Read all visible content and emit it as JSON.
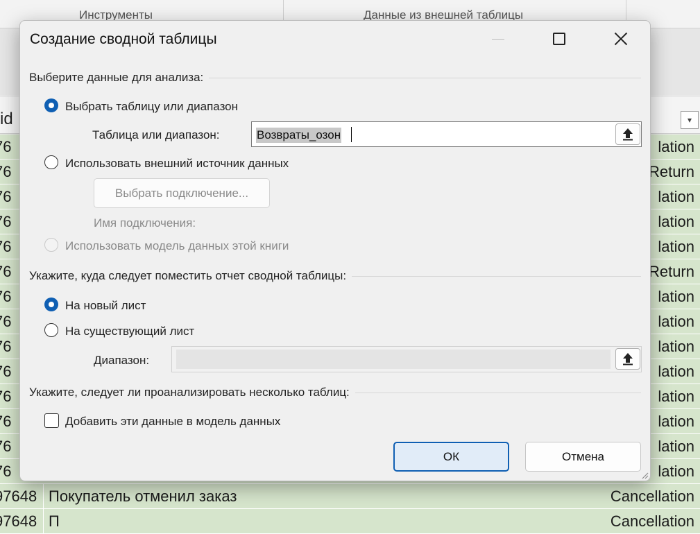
{
  "background": {
    "ribbon_groups": [
      "Инструменты",
      "Данные из внешней таблицы"
    ],
    "column_id_header": "id",
    "row_partial_id": "76",
    "rows": [
      {
        "status": "lation"
      },
      {
        "status": "Return"
      },
      {
        "status": "lation"
      },
      {
        "status": "lation"
      },
      {
        "status": "lation"
      },
      {
        "status": "Return"
      },
      {
        "status": "lation"
      },
      {
        "status": "lation"
      },
      {
        "status": "lation"
      },
      {
        "status": "lation"
      },
      {
        "status": "lation"
      },
      {
        "status": "lation"
      },
      {
        "status": "lation"
      },
      {
        "status": "lation"
      }
    ],
    "visible_row": {
      "id": "97648",
      "text": "Покупатель отменил заказ",
      "status": "Cancellation"
    },
    "last_row": {
      "id": "97648",
      "text": "П",
      "status": "Cancellation"
    },
    "row_color": "#d6e5cc"
  },
  "dialog": {
    "title": "Создание сводной таблицы",
    "section1": "Выберите данные для анализа:",
    "radio_table": "Выбрать таблицу или диапазон",
    "table_range_label": "Таблица или диапазон:",
    "table_range_value": "Возвраты_озон",
    "radio_external": "Использовать внешний источник данных",
    "choose_connection_button": "Выбрать подключение...",
    "connection_name_label": "Имя подключения:",
    "radio_data_model": "Использовать модель данных этой книги",
    "section2": "Укажите, куда следует поместить отчет сводной таблицы:",
    "radio_new_sheet": "На новый лист",
    "radio_existing_sheet": "На существующий лист",
    "range_label": "Диапазон:",
    "range_value": "",
    "section3": "Укажите, следует ли проанализировать несколько таблиц:",
    "checkbox_data_model": "Добавить эти данные в модель данных",
    "ok_button": "ОК",
    "cancel_button": "Отмена",
    "accent_color": "#0f5fb3"
  }
}
